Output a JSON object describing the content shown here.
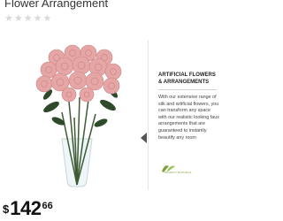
{
  "product": {
    "title": "Flower Arrangement",
    "rating": {
      "stars_total": 5,
      "stars_filled": 0
    }
  },
  "info_card": {
    "title": "ARTIFICIAL FLOWERS & ARRANGEMENTS",
    "body": "With our extensive range of silk and artificial flowers, you can transform any space with our realistic looking faux arrangements that are guaranteed to instantly beautify any room",
    "brand": "NEARLY NATURAL"
  },
  "price": {
    "currency": "$",
    "dollars": "142",
    "cents": "66"
  },
  "icons": {
    "star": "star-icon",
    "nav": "chevron-left-icon"
  },
  "colors": {
    "star_empty": "#d9d9d9",
    "rose": "#e7a6a6",
    "leaf": "#2f4a2a",
    "brand": "#7aa23a"
  }
}
